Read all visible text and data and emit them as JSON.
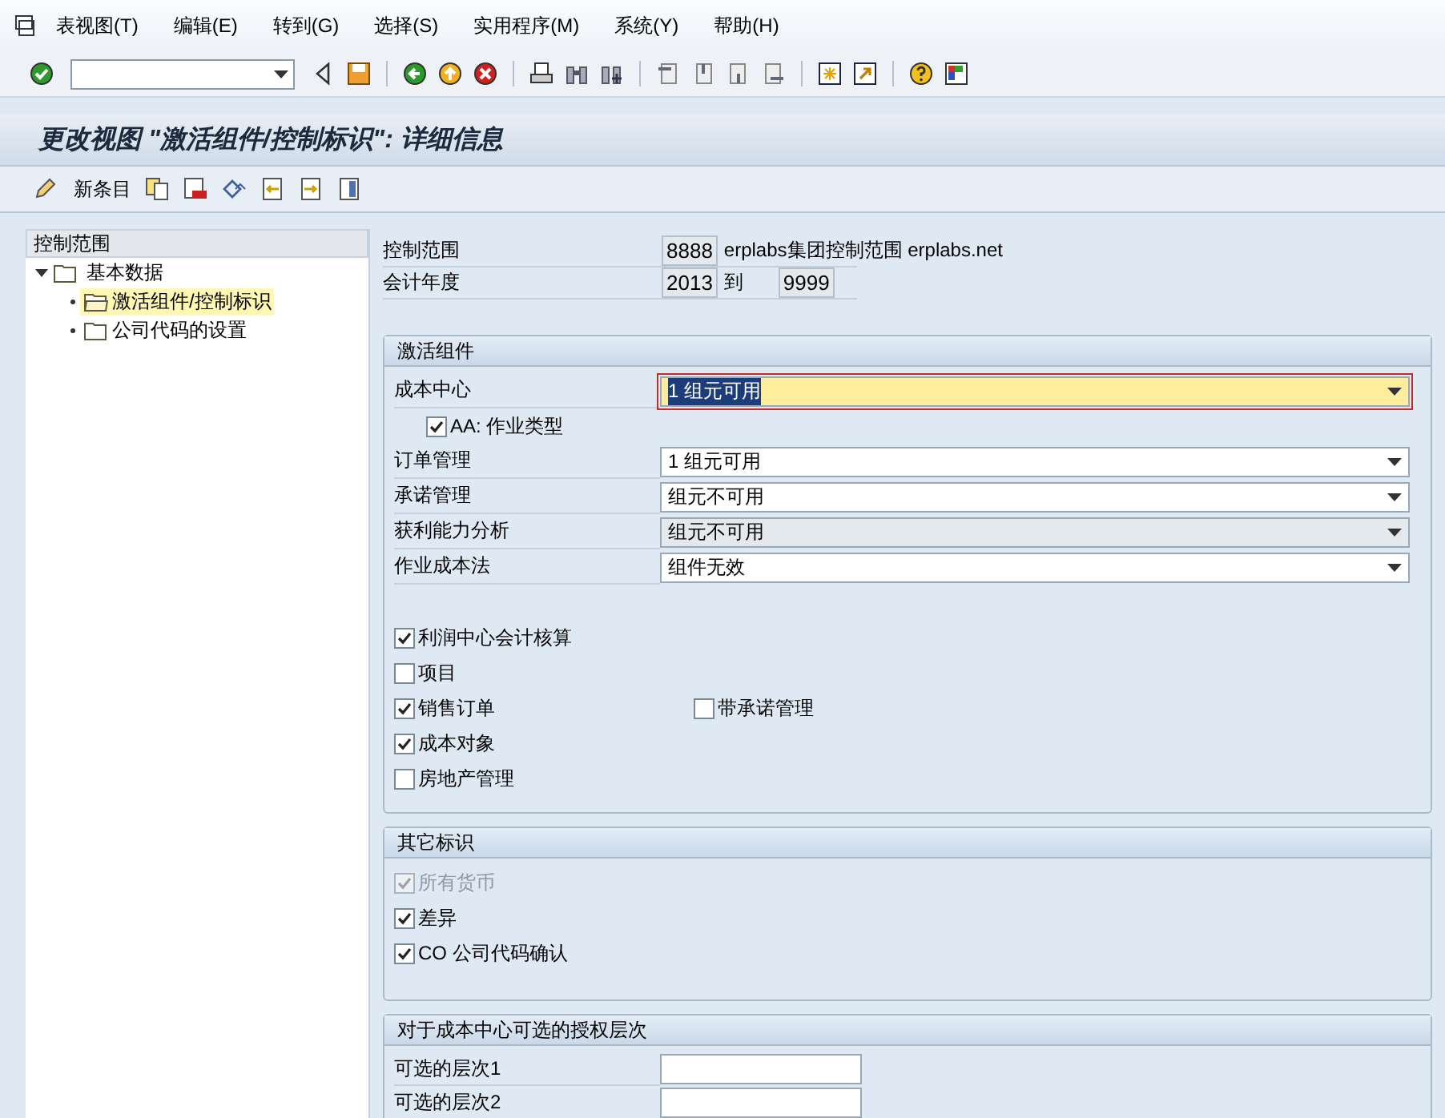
{
  "menu_bar": [
    {
      "label": "表视图(T)"
    },
    {
      "label": "编辑(E)"
    },
    {
      "label": "转到(G)"
    },
    {
      "label": "选择(S)"
    },
    {
      "label": "实用程序(M)"
    },
    {
      "label": "系统(Y)"
    },
    {
      "label": "帮助(H)"
    }
  ],
  "title": "更改视图 \"激活组件/控制标识\": 详细信息",
  "app_toolbar": {
    "new_entries": "新条目"
  },
  "sidebar": {
    "header": "控制范围",
    "items": [
      {
        "label": "基本数据",
        "expanded": true,
        "selected": false,
        "children": [
          {
            "label": "激活组件/控制标识",
            "selected": true
          },
          {
            "label": "公司代码的设置",
            "selected": false
          }
        ]
      }
    ]
  },
  "header_fields": [
    {
      "label": "控制范围",
      "value": "8888",
      "text": "erplabs集团控制范围 erplabs.net"
    },
    {
      "label": "会计年度",
      "value": "2013",
      "text": "到",
      "value_2": "9999"
    }
  ],
  "active_components": {
    "title": "激活组件",
    "dropdowns": [
      {
        "label": "成本中心",
        "value": "1 组元可用",
        "focused": true,
        "disabled": false
      },
      {
        "label": "订单管理",
        "value": "1 组元可用",
        "focused": false,
        "disabled": false
      },
      {
        "label": "承诺管理",
        "value": "组元不可用",
        "focused": false,
        "disabled": false
      },
      {
        "label": "获利能力分析",
        "value": "组元不可用",
        "focused": false,
        "disabled": true
      },
      {
        "label": "作业成本法",
        "value": "组件无效",
        "focused": false,
        "disabled": false
      }
    ],
    "sub_checkbox": {
      "label": "AA: 作业类型",
      "checked": true
    },
    "checkboxes": [
      {
        "label": "利润中心会计核算",
        "checked": true
      },
      {
        "label": "项目",
        "checked": false
      },
      {
        "label": "销售订单",
        "checked": true,
        "extra": {
          "label": "带承诺管理",
          "checked": false
        }
      },
      {
        "label": "成本对象",
        "checked": true
      },
      {
        "label": "房地产管理",
        "checked": false
      }
    ]
  },
  "other_flags": {
    "title": "其它标识",
    "checkboxes": [
      {
        "label": "所有货币",
        "checked": true,
        "disabled": true
      },
      {
        "label": "差异",
        "checked": true,
        "disabled": false
      },
      {
        "label": "CO 公司代码确认",
        "checked": true,
        "disabled": false
      }
    ]
  },
  "auth_levels": {
    "title": "对于成本中心可选的授权层次",
    "fields": [
      {
        "label": "可选的层次1"
      },
      {
        "label": "可选的层次2"
      }
    ]
  }
}
